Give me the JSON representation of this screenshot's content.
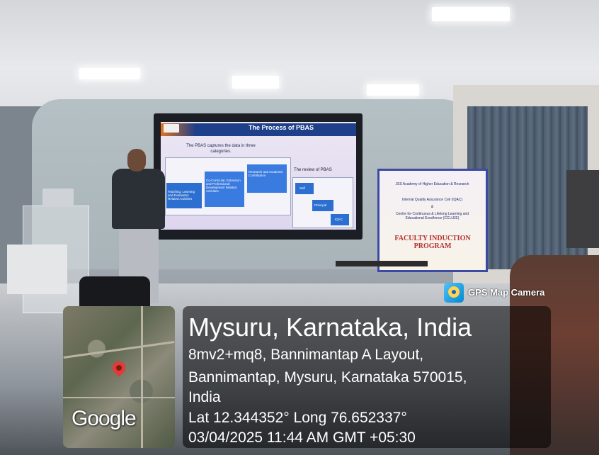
{
  "slide": {
    "title": "The Process of PBAS",
    "subtitle": "The PBAS captures the data in three categories.",
    "review_label": "The review of PBAS",
    "box_left": "Teaching, Learning and Evaluation Related Activities",
    "box_mid": "Co-Curricular, Extension and Professional Development Related Activities",
    "box_right": "Research and Academic Contribution",
    "flow_1": "Self",
    "flow_2": "Principal",
    "flow_3": "IQAC"
  },
  "banner": {
    "line1": "JSS Academy of Higher Education & Research",
    "line2": "Internal Quality Assurance Cell (IQAC)",
    "line3": "&",
    "line4": "Centre for Continuous & Lifelong Learning and Educational Excellence (CCLLEE)",
    "title": "FACULTY INDUCTION PROGRAM"
  },
  "overlay": {
    "badge": "GPS Map Camera",
    "map_brand": "Google",
    "location_title": "Mysuru, Karnataka, India",
    "address_line1": "8mv2+mq8, Bannimantap A Layout,",
    "address_line2": "Bannimantap, Mysuru, Karnataka 570015,",
    "address_line3": "India",
    "coordinates": "Lat 12.344352° Long 76.652337°",
    "timestamp": "03/04/2025 11:44 AM GMT +05:30"
  },
  "colors": {
    "pin": "#e53935",
    "slide_header": "#1e3f8a",
    "banner_border": "#3b4aa3",
    "banner_title": "#b7302a"
  },
  "icons": [
    "map-pin-icon",
    "gps-map-camera-icon"
  ]
}
